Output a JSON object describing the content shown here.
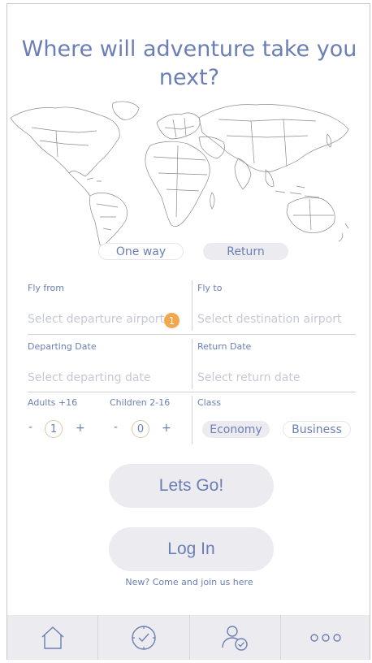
{
  "header": {
    "title": "Where will adventure take you next?"
  },
  "trip_type": {
    "one_way": "One way",
    "return": "Return",
    "selected": "Return"
  },
  "fly_from": {
    "label": "Fly from",
    "placeholder": "Select departure airport",
    "badge": "1"
  },
  "fly_to": {
    "label": "Fly to",
    "placeholder": "Select destination airport"
  },
  "departing": {
    "label": "Departing Date",
    "placeholder": "Select departing date"
  },
  "returning": {
    "label": "Return Date",
    "placeholder": "Select return date"
  },
  "adults": {
    "label": "Adults +16",
    "value": "1",
    "minus": "-",
    "plus": "+"
  },
  "children": {
    "label": "Children 2-16",
    "value": "0",
    "minus": "-",
    "plus": "+"
  },
  "class": {
    "label": "Class",
    "economy": "Economy",
    "business": "Business",
    "selected": "Economy"
  },
  "actions": {
    "go": "Lets Go!",
    "login": "Log In",
    "join": "New? Come and join us here"
  },
  "tabbar": {
    "items": [
      "home-icon",
      "clock-icon",
      "user-check-icon",
      "more-icon"
    ]
  },
  "colors": {
    "accent": "#6b7fb5",
    "badge": "#f2a74b",
    "pill_bg": "#ececf0",
    "placeholder": "#c6c8d6"
  }
}
